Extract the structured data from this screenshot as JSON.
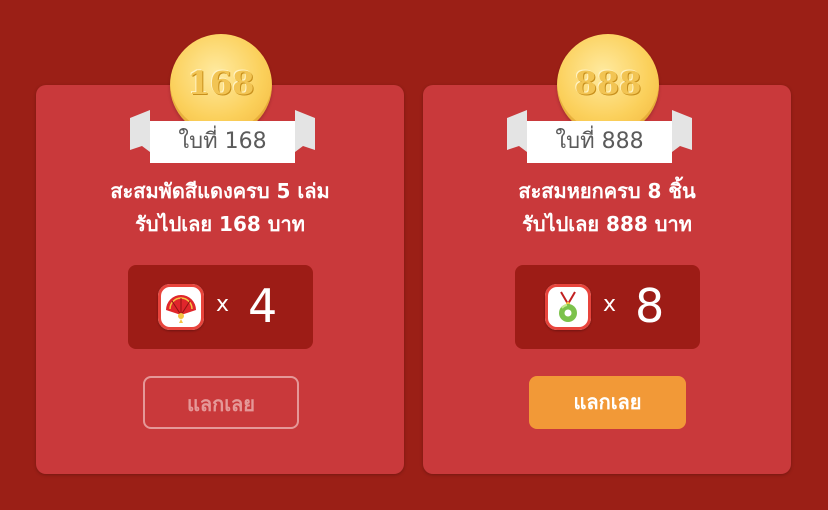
{
  "rewards": [
    {
      "coin_number": "168",
      "ribbon_label": "ใบที่ 168",
      "description_line1": "สะสมพัดสีแดงครบ 5 เล่ม",
      "description_line2": "รับไปเลย 168 บาท",
      "item_icon": "red-fan-icon",
      "times_label": "x",
      "quantity": "4",
      "button_label": "แลกเลย",
      "button_state": "disabled"
    },
    {
      "coin_number": "888",
      "ribbon_label": "ใบที่ 888",
      "description_line1": "สะสมหยกครบ 8 ชิ้น",
      "description_line2": "รับไปเลย 888 บาท",
      "item_icon": "jade-pendant-icon",
      "times_label": "x",
      "quantity": "8",
      "button_label": "แลกเลย",
      "button_state": "active"
    }
  ],
  "colors": {
    "background": "#9b1f16",
    "card": "#c9393b",
    "count_box": "#9d1c16",
    "button_active": "#f29937",
    "button_disabled_border": "#e59898"
  }
}
